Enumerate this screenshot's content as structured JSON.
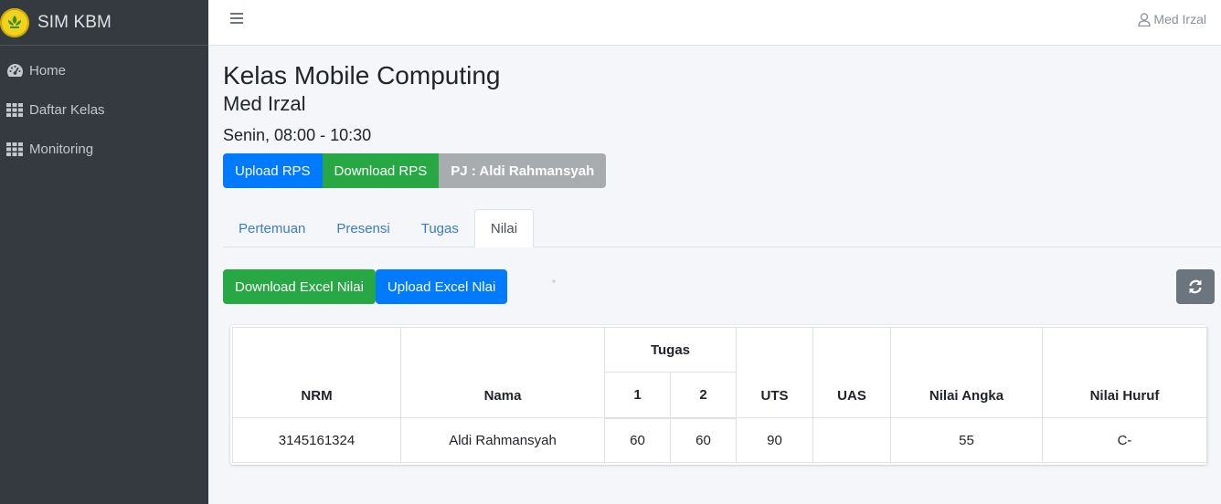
{
  "brand": {
    "name": "SIM KBM",
    "logo_icon": "leaf-emblem-icon",
    "logo_color": "#f2d21b"
  },
  "sidebar": {
    "items": [
      {
        "label": "Home",
        "icon": "dashboard-icon"
      },
      {
        "label": "Daftar Kelas",
        "icon": "grid-icon"
      },
      {
        "label": "Monitoring",
        "icon": "grid-icon"
      }
    ]
  },
  "topbar": {
    "menu_icon": "hamburger-icon",
    "user_name": "Med Irzal",
    "user_icon": "user-icon"
  },
  "main": {
    "title": "Kelas Mobile Computing",
    "lecturer": "Med Irzal",
    "schedule": "Senin, 08:00 - 10:30",
    "buttons": {
      "upload_rps": "Upload RPS",
      "download_rps": "Download RPS",
      "pj": "PJ : Aldi Rahmansyah"
    },
    "tabs": [
      {
        "label": "Pertemuan",
        "active": false
      },
      {
        "label": "Presensi",
        "active": false
      },
      {
        "label": "Tugas",
        "active": false
      },
      {
        "label": "Nilai",
        "active": true
      }
    ],
    "excel": {
      "download": "Download Excel Nilai",
      "upload": "Upload Excel Nlai",
      "marker": "°"
    },
    "refresh_icon": "refresh-icon"
  },
  "table": {
    "headers": {
      "nrm": "NRM",
      "nama": "Nama",
      "tugas": "Tugas",
      "tugas_1": "1",
      "tugas_2": "2",
      "uts": "UTS",
      "uas": "UAS",
      "nilai_angka": "Nilai Angka",
      "nilai_huruf": "Nilai Huruf"
    },
    "rows": [
      {
        "nrm": "3145161324",
        "nama": "Aldi Rahmansyah",
        "tugas_1": "60",
        "tugas_2": "60",
        "uts": "90",
        "uas": "",
        "nilai_angka": "55",
        "nilai_huruf": "C-"
      }
    ]
  },
  "colors": {
    "sidebar_bg": "#343a40",
    "primary": "#007bff",
    "success": "#28a745",
    "secondary": "#a9acaf"
  }
}
